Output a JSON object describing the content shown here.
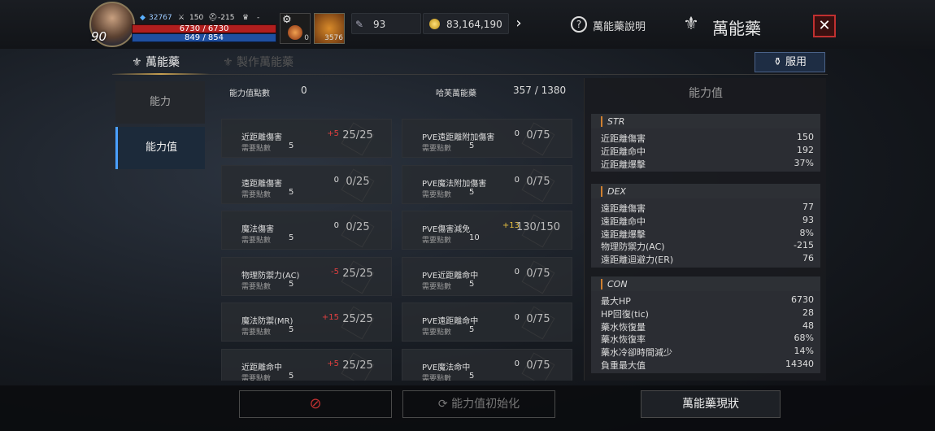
{
  "player": {
    "level": "90",
    "gem": "32767",
    "attack": "150",
    "defense": "-215",
    "trophy": "-",
    "hp": "6730 / 6730",
    "mp": "849 / 854",
    "hp_frac": 1.0,
    "mp_frac": 0.993,
    "potion_count": "0",
    "potion2_count": "3576"
  },
  "currency": {
    "feather": "93",
    "gold": "83,164,190"
  },
  "header": {
    "help_label": "萬能藥說明",
    "title": "萬能藥",
    "close": "✕"
  },
  "tabs": {
    "active": "萬能藥",
    "inactive": "製作萬能藥",
    "use_button": "服用"
  },
  "sidebar": [
    "能力",
    "能力值"
  ],
  "summary": {
    "points_label": "能力值點數",
    "points_value": "0",
    "rank_label": "哈芙萬能藥",
    "rank_value": "357 / 1380"
  },
  "cards": [
    {
      "name": "近距離傷害",
      "bonus": "+5",
      "bonus_color": "#e04040",
      "progress": "25/25",
      "sub": "需要點數",
      "pts": "5"
    },
    {
      "name": "PVE遠距離附加傷害",
      "bonus": "0",
      "bonus_color": "#ddd",
      "progress": "0/75",
      "sub": "需要點數",
      "pts": "5"
    },
    {
      "name": "遠距離傷害",
      "bonus": "0",
      "bonus_color": "#ddd",
      "progress": "0/25",
      "sub": "需要點數",
      "pts": "5"
    },
    {
      "name": "PVE魔法附加傷害",
      "bonus": "0",
      "bonus_color": "#ddd",
      "progress": "0/75",
      "sub": "需要點數",
      "pts": "5"
    },
    {
      "name": "魔法傷害",
      "bonus": "0",
      "bonus_color": "#ddd",
      "progress": "0/25",
      "sub": "需要點數",
      "pts": "5"
    },
    {
      "name": "PVE傷害減免",
      "bonus": "+13",
      "bonus_color": "#e8c040",
      "progress": "130/150",
      "sub": "需要點數",
      "pts": "10"
    },
    {
      "name": "物理防禦力(AC)",
      "bonus": "-5",
      "bonus_color": "#e04040",
      "progress": "25/25",
      "sub": "需要點數",
      "pts": "5"
    },
    {
      "name": "PVE近距離命中",
      "bonus": "0",
      "bonus_color": "#ddd",
      "progress": "0/75",
      "sub": "需要點數",
      "pts": "5"
    },
    {
      "name": "魔法防禦(MR)",
      "bonus": "+15",
      "bonus_color": "#e04040",
      "progress": "25/25",
      "sub": "需要點數",
      "pts": "5"
    },
    {
      "name": "PVE遠距離命中",
      "bonus": "0",
      "bonus_color": "#ddd",
      "progress": "0/75",
      "sub": "需要點數",
      "pts": "5"
    },
    {
      "name": "近距離命中",
      "bonus": "+5",
      "bonus_color": "#e04040",
      "progress": "25/25",
      "sub": "需要點數",
      "pts": "5"
    },
    {
      "name": "PVE魔法命中",
      "bonus": "0",
      "bonus_color": "#ddd",
      "progress": "0/75",
      "sub": "需要點數",
      "pts": "5"
    }
  ],
  "stats": {
    "title": "能力值",
    "sections": [
      {
        "name": "STR",
        "rows": [
          [
            "近距離傷害",
            "150"
          ],
          [
            "近距離命中",
            "192"
          ],
          [
            "近距離爆擊",
            "37%"
          ]
        ]
      },
      {
        "name": "DEX",
        "rows": [
          [
            "遠距離傷害",
            "77"
          ],
          [
            "遠距離命中",
            "93"
          ],
          [
            "遠距離爆擊",
            "8%"
          ],
          [
            "物理防禦力(AC)",
            "-215"
          ],
          [
            "遠距離迴避力(ER)",
            "76"
          ]
        ]
      },
      {
        "name": "CON",
        "rows": [
          [
            "最大HP",
            "6730"
          ],
          [
            "HP回復(tic)",
            "28"
          ],
          [
            "藥水恢復量",
            "48"
          ],
          [
            "藥水恢復率",
            "68%"
          ],
          [
            "藥水冷卻時間減少",
            "14%"
          ],
          [
            "負重最大值",
            "14340"
          ]
        ]
      }
    ]
  },
  "bottom": {
    "btn1": "",
    "btn2": "能力值初始化",
    "btn3": "萬能藥現狀"
  }
}
